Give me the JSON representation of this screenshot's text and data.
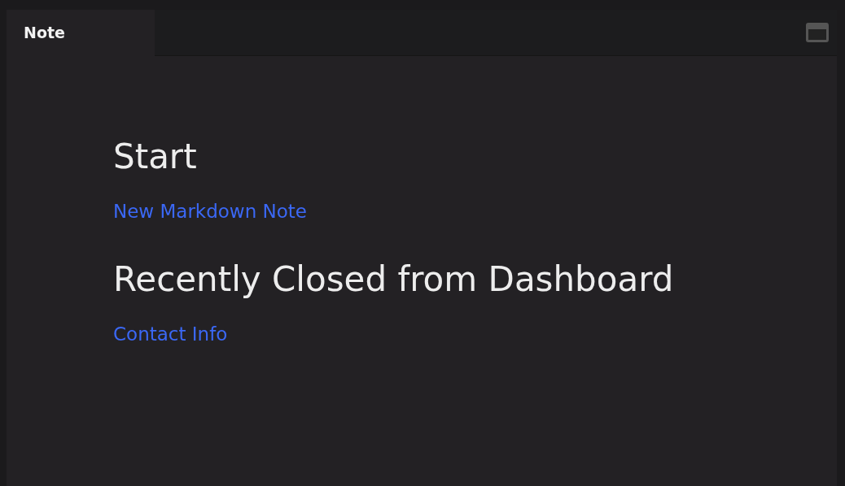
{
  "tabs": [
    {
      "label": "Note",
      "selected": true
    }
  ],
  "sections": [
    {
      "title": "Start",
      "links": [
        "New Markdown Note"
      ]
    },
    {
      "title": "Recently Closed from Dashboard",
      "links": [
        "Contact Info"
      ]
    }
  ]
}
